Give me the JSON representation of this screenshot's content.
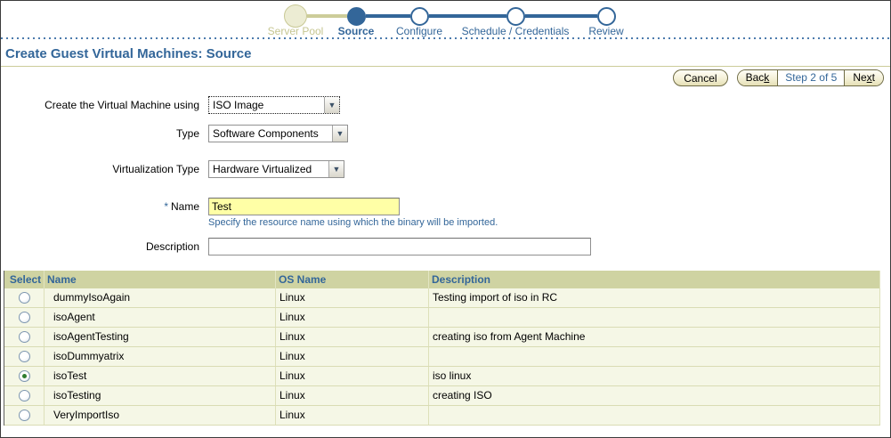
{
  "colors": {
    "accent_blue": "#336699",
    "train_tan": "#CCCC99",
    "table_header_bg": "#CFD3A2",
    "table_row_bg": "#F5F7E6",
    "required_field_bg": "#FFFFA6",
    "button_border": "#6E6B45",
    "selected_radio_dot": "#2F7D2F"
  },
  "train": {
    "steps": [
      {
        "label": "Server Pool",
        "state": "visited"
      },
      {
        "label": "Source",
        "state": "current"
      },
      {
        "label": "Configure",
        "state": "future"
      },
      {
        "label": "Schedule / Credentials",
        "state": "future"
      },
      {
        "label": "Review",
        "state": "future"
      }
    ]
  },
  "header": {
    "title": "Create Guest Virtual Machines: Source"
  },
  "nav": {
    "cancel_label": "Cancel",
    "back_prefix": "Bac",
    "back_accesskey": "k",
    "back_suffix": "",
    "step_indicator": "Step 2 of 5",
    "next_prefix": "Ne",
    "next_accesskey": "x",
    "next_suffix": "t"
  },
  "form": {
    "create_using": {
      "label": "Create the Virtual Machine using",
      "value": "ISO Image"
    },
    "type": {
      "label": "Type",
      "value": "Software Components"
    },
    "virtualization_type": {
      "label": "Virtualization Type",
      "value": "Hardware Virtualized"
    },
    "name": {
      "required_marker": "*",
      "label": "Name",
      "value": "Test",
      "hint": "Specify the resource name using which the binary will be imported."
    },
    "description": {
      "label": "Description",
      "value": ""
    }
  },
  "table": {
    "columns": [
      "Select",
      "Name",
      "OS Name",
      "Description"
    ],
    "selected_row_name": "isoTest",
    "rows": [
      {
        "name": "dummyIsoAgain",
        "os_name": "Linux",
        "description": "Testing import of iso in RC"
      },
      {
        "name": "isoAgent",
        "os_name": "Linux",
        "description": ""
      },
      {
        "name": "isoAgentTesting",
        "os_name": "Linux",
        "description": "creating iso from Agent Machine"
      },
      {
        "name": "isoDummyatrix",
        "os_name": "Linux",
        "description": ""
      },
      {
        "name": "isoTest",
        "os_name": "Linux",
        "description": "iso linux"
      },
      {
        "name": "isoTesting",
        "os_name": "Linux",
        "description": "creating ISO"
      },
      {
        "name": "VeryImportIso",
        "os_name": "Linux",
        "description": ""
      }
    ]
  }
}
